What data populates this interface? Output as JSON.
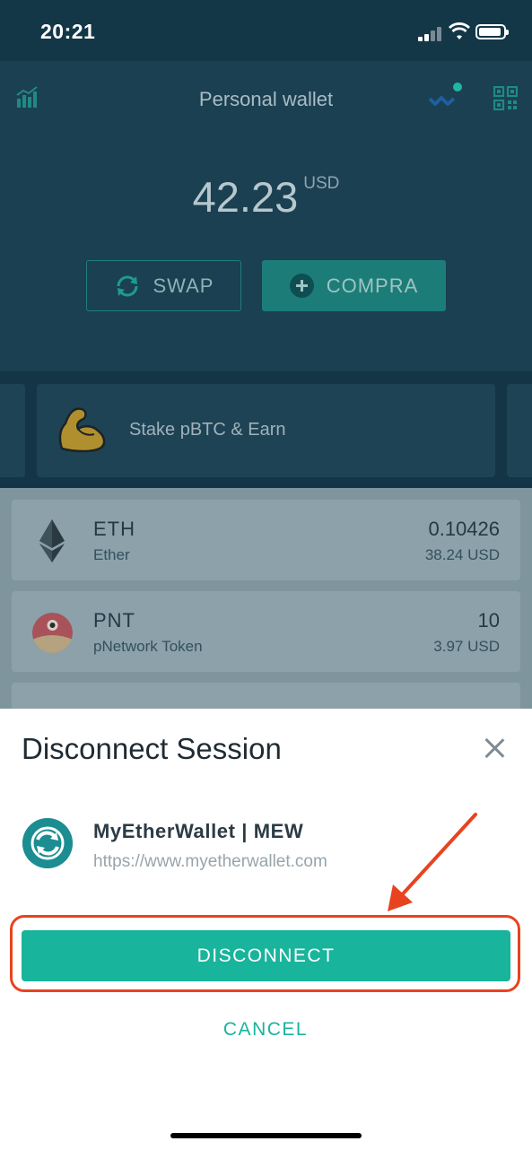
{
  "status_bar": {
    "time": "20:21"
  },
  "header": {
    "title": "Personal wallet",
    "balance": "42.23",
    "currency": "USD",
    "swap_label": "SWAP",
    "buy_label": "COMPRA"
  },
  "promo": {
    "text": "Stake pBTC & Earn"
  },
  "tokens": [
    {
      "symbol": "ETH",
      "name": "Ether",
      "amount": "0.10426",
      "usd": "38.24 USD"
    },
    {
      "symbol": "PNT",
      "name": "pNetwork Token",
      "amount": "10",
      "usd": "3.97 USD"
    }
  ],
  "sheet": {
    "title": "Disconnect Session",
    "dapp_name": "MyEtherWallet | MEW",
    "dapp_url": "https://www.myetherwallet.com",
    "disconnect_label": "DISCONNECT",
    "cancel_label": "CANCEL"
  },
  "colors": {
    "accent": "#18b49c",
    "annotation": "#e8431f",
    "header_bg": "#1a4052"
  },
  "icons": [
    "chart-icon",
    "walletconnect-icon",
    "qr-code-icon",
    "swap-icon",
    "plus-icon",
    "flexed-arm-icon",
    "eth-icon",
    "pnt-icon",
    "close-icon",
    "mew-logo-icon",
    "annotation-arrow"
  ]
}
